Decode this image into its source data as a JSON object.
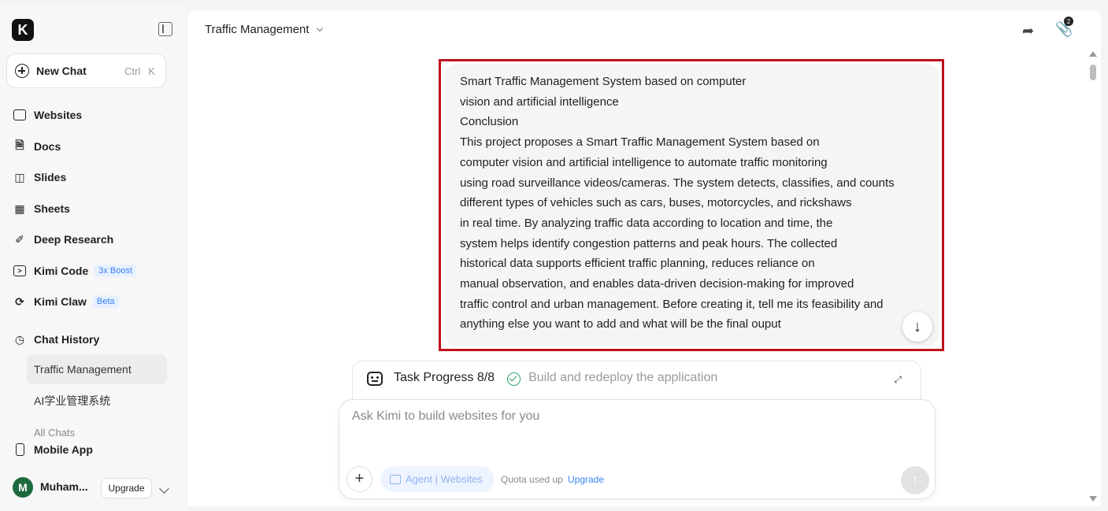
{
  "sidebar": {
    "logo": "K",
    "new_chat": {
      "label": "New Chat",
      "shortcut": [
        "Ctrl",
        "K"
      ]
    },
    "items": [
      {
        "label": "Websites",
        "icon": "browser-window-icon"
      },
      {
        "label": "Docs",
        "icon": "document-icon"
      },
      {
        "label": "Slides",
        "icon": "presentation-icon"
      },
      {
        "label": "Sheets",
        "icon": "table-icon"
      },
      {
        "label": "Deep Research",
        "icon": "research-icon"
      },
      {
        "label": "Kimi Code",
        "icon": "terminal-icon",
        "badge": "3x Boost"
      },
      {
        "label": "Kimi Claw",
        "icon": "claw-icon",
        "badge": "Beta"
      }
    ],
    "chat_history": {
      "label": "Chat History",
      "items": [
        "Traffic Management",
        "AI学业管理系统"
      ],
      "all_chats": "All Chats"
    },
    "mobile_app": "Mobile App",
    "user": {
      "initial": "M",
      "name": "Muham...",
      "upgrade": "Upgrade"
    }
  },
  "header": {
    "title": "Traffic Management",
    "attachments_count": "2"
  },
  "message": {
    "lines": [
      "Smart Traffic Management System based on computer",
      "vision and artificial intelligence",
      "Conclusion",
      "This project proposes a Smart Traffic Management System based on",
      "computer vision and artificial intelligence to automate traffic monitoring",
      "using road surveillance videos/cameras. The system detects, classifies, and counts",
      "different types of vehicles such as cars, buses, motorcycles, and rickshaws",
      "in real time. By analyzing traffic data according to location and time, the",
      "system helps identify congestion patterns and peak hours. The collected",
      "historical data supports efficient traffic planning, reduces reliance on",
      "manual observation, and enables data-driven decision-making for improved",
      "traffic control and urban management. Before creating it, tell me its feasibility and",
      "anything else you want to add and what will be the final ouput"
    ]
  },
  "task": {
    "label": "Task Progress 8/8",
    "description": "Build and redeploy the application"
  },
  "input": {
    "placeholder": "Ask Kimi to build websites for you",
    "agent_label": "Agent | Websites",
    "quota": "Quota used up",
    "upgrade": "Upgrade"
  },
  "colors": {
    "highlight_frame": "#c0111c",
    "accent": "#3b82f6",
    "success": "#2fa36b"
  }
}
